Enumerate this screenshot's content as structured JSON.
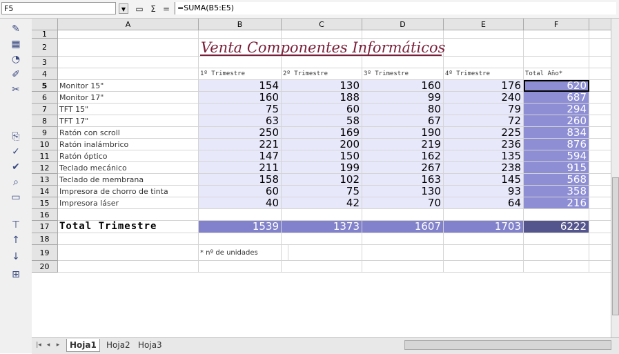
{
  "formula_bar": {
    "cell_ref": "F5",
    "formula": "=SUMA(B5:E5)",
    "icons": [
      "dropdown-icon",
      "function-wizard-icon",
      "sum-icon",
      "equals-icon"
    ],
    "sum_glyph": "Σ",
    "equals_glyph": "="
  },
  "columns": [
    "A",
    "B",
    "C",
    "D",
    "E",
    "F"
  ],
  "rows": [
    "1",
    "2",
    "3",
    "4",
    "5",
    "6",
    "7",
    "8",
    "9",
    "10",
    "11",
    "12",
    "13",
    "14",
    "15",
    "16",
    "17",
    "18",
    "19",
    "20"
  ],
  "title": "Venta Componentes Informáticos",
  "headers": [
    "1º Trimestre",
    "2º Trimestre",
    "3º Trimestre",
    "4º Trimestre",
    "Total Año*"
  ],
  "products": [
    {
      "name": "Monitor 15\"",
      "q": [
        154,
        130,
        160,
        176
      ],
      "total": 620
    },
    {
      "name": "Monitor 17\"",
      "q": [
        160,
        188,
        99,
        240
      ],
      "total": 687
    },
    {
      "name": "TFT 15\"",
      "q": [
        75,
        60,
        80,
        79
      ],
      "total": 294
    },
    {
      "name": "TFT 17\"",
      "q": [
        63,
        58,
        67,
        72
      ],
      "total": 260
    },
    {
      "name": "Ratón con scroll",
      "q": [
        250,
        169,
        190,
        225
      ],
      "total": 834
    },
    {
      "name": "Ratón inalámbrico",
      "q": [
        221,
        200,
        219,
        236
      ],
      "total": 876
    },
    {
      "name": "Ratón óptico",
      "q": [
        147,
        150,
        162,
        135
      ],
      "total": 594
    },
    {
      "name": "Teclado mecánico",
      "q": [
        211,
        199,
        267,
        238
      ],
      "total": 915
    },
    {
      "name": "Teclado de membrana",
      "q": [
        158,
        102,
        163,
        145
      ],
      "total": 568
    },
    {
      "name": "Impresora de chorro de tinta",
      "q": [
        60,
        75,
        130,
        93
      ],
      "total": 358
    },
    {
      "name": "Impresora láser",
      "q": [
        40,
        42,
        70,
        64
      ],
      "total": 216
    }
  ],
  "total_row": {
    "label": "Total Trimestre",
    "q": [
      1539,
      1373,
      1607,
      1703
    ],
    "grand": 6222
  },
  "footnote": "* nº de unidades",
  "sheet_tabs": [
    "Hoja1",
    "Hoja2",
    "Hoja3"
  ],
  "active_tab": "Hoja1",
  "colors": {
    "title": "#7a1f3a",
    "quarter_bg": "#e8e8fb",
    "total_bg": "#8e8ed4",
    "grand_bg": "#55558e"
  },
  "left_toolbar_icons": [
    "new-document-icon",
    "table-icon",
    "chart-icon",
    "draw-icon",
    "scissors-icon",
    "open-icon",
    "spellcheck-icon",
    "autospell-icon",
    "find-icon",
    "border-icon",
    "filter-icon",
    "sort-ascending-icon",
    "sort-descending-icon",
    "insert-icon"
  ]
}
